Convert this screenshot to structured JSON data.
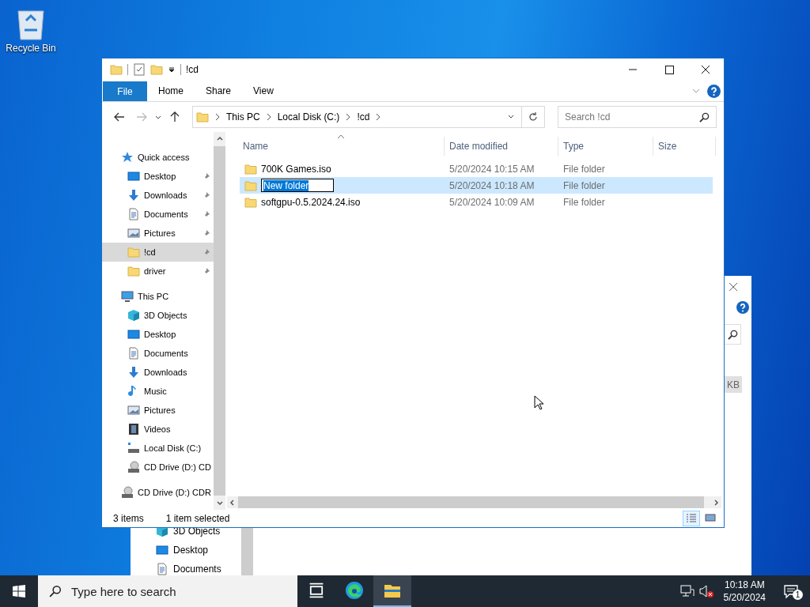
{
  "desktop": {
    "icons": [
      {
        "kind": "recycle",
        "label": "Recycle Bin"
      }
    ]
  },
  "back_window": {
    "nav_items": [
      {
        "kind": "objects",
        "label": "3D Objects"
      },
      {
        "kind": "desktop",
        "label": "Desktop"
      },
      {
        "kind": "documents",
        "label": "Documents"
      }
    ],
    "size_unit": "KB"
  },
  "window": {
    "title": "!cd",
    "file_tab": "File",
    "ribbon_tabs": [
      "Home",
      "Share",
      "View"
    ],
    "breadcrumbs": [
      "This PC",
      "Local Disk (C:)",
      "!cd"
    ],
    "search": {
      "placeholder": "Search !cd"
    },
    "nav_tree": [
      {
        "kind": "star",
        "label": "Quick access",
        "selected": false,
        "children": [
          {
            "kind": "desktop",
            "label": "Desktop",
            "selected": false,
            "pinned": true
          },
          {
            "kind": "downloads",
            "label": "Downloads",
            "selected": false,
            "pinned": true
          },
          {
            "kind": "documents",
            "label": "Documents",
            "selected": false,
            "pinned": true
          },
          {
            "kind": "pictures",
            "label": "Pictures",
            "selected": false,
            "pinned": true
          },
          {
            "kind": "folder",
            "label": "!cd",
            "selected": true,
            "pinned": true
          },
          {
            "kind": "folder",
            "label": "driver",
            "selected": false,
            "pinned": true
          }
        ]
      },
      {
        "kind": "pc",
        "label": "This PC",
        "selected": false,
        "children": [
          {
            "kind": "objects",
            "label": "3D Objects",
            "selected": false
          },
          {
            "kind": "desktop",
            "label": "Desktop",
            "selected": false
          },
          {
            "kind": "documents",
            "label": "Documents",
            "selected": false
          },
          {
            "kind": "downloads",
            "label": "Downloads",
            "selected": false
          },
          {
            "kind": "music",
            "label": "Music",
            "selected": false
          },
          {
            "kind": "pictures",
            "label": "Pictures",
            "selected": false
          },
          {
            "kind": "videos",
            "label": "Videos",
            "selected": false
          },
          {
            "kind": "disk",
            "label": "Local Disk (C:)",
            "selected": false
          },
          {
            "kind": "cd",
            "label": "CD Drive (D:) CD",
            "selected": false
          }
        ]
      },
      {
        "kind": "cd",
        "label": "CD Drive (D:) CDR",
        "selected": false
      }
    ],
    "columns": [
      "Name",
      "Date modified",
      "Type",
      "Size"
    ],
    "rows": [
      {
        "name": "700K Games.iso",
        "date": "5/20/2024 10:15 AM",
        "type": "File folder",
        "selected": false,
        "renaming": false
      },
      {
        "name": "New folder",
        "date": "5/20/2024 10:18 AM",
        "type": "File folder",
        "selected": true,
        "renaming": true
      },
      {
        "name": "softgpu-0.5.2024.24.iso",
        "date": "5/20/2024 10:09 AM",
        "type": "File folder",
        "selected": false,
        "renaming": false
      }
    ],
    "status_bar": {
      "count": "3 items",
      "selection": "1 item selected"
    },
    "views": [
      {
        "kind": "details",
        "selected": true
      },
      {
        "kind": "tiles",
        "selected": false
      }
    ]
  },
  "taskbar": {
    "search": {
      "placeholder": "Type here to search"
    },
    "apps": [
      {
        "kind": "taskview",
        "active": false
      },
      {
        "kind": "edge",
        "active": false
      },
      {
        "kind": "explorer",
        "active": true
      }
    ],
    "time": "10:18 AM",
    "date": "5/20/2024",
    "notifications": "1"
  }
}
